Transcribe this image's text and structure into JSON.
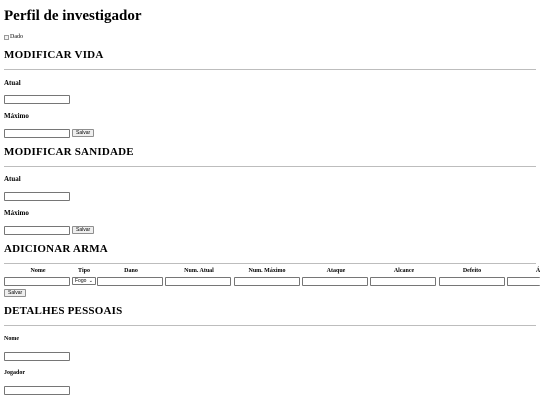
{
  "page": {
    "title": "Perfil de investigador",
    "image_alt": "Dado"
  },
  "vida": {
    "heading": "MODIFICAR VIDA",
    "atual_label": "Atual",
    "maximo_label": "Máximo",
    "save_label": "Salvar"
  },
  "sanidade": {
    "heading": "MODIFICAR SANIDADE",
    "atual_label": "Atual",
    "maximo_label": "Máximo",
    "save_label": "Salvar"
  },
  "arma": {
    "heading": "ADICIONAR ARMA",
    "columns": [
      "Nome",
      "Tipo",
      "Dano",
      "Num. Atual",
      "Num. Máximo",
      "Ataque",
      "Alcance",
      "Defeito",
      "Á"
    ],
    "tipo_selected": "Fogo",
    "save_label": "Salvar"
  },
  "detalhes": {
    "heading": "DETALHES PESSOAIS",
    "nome_label": "Nome",
    "jogador_label": "Jogador"
  }
}
